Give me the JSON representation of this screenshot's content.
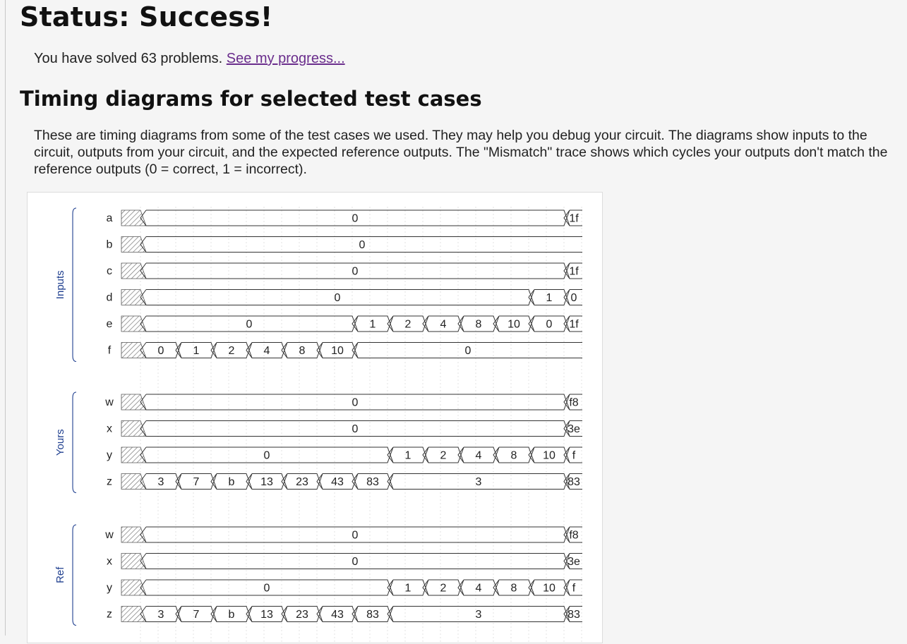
{
  "status": {
    "title": "Status: Success!"
  },
  "progress": {
    "text": "You have solved 63 problems.",
    "link": "See my progress..."
  },
  "section": {
    "title": "Timing diagrams for selected test cases",
    "description": "These are timing diagrams from some of the test cases we used. They may help you debug your circuit. The diagrams show inputs to the circuit, outputs from your circuit, and the expected reference outputs. The \"Mismatch\" trace shows which cycles your outputs don't match the reference outputs (0 = correct, 1 = incorrect)."
  },
  "colors": {
    "link": "#6a2d8c",
    "group_label": "#1f3f8f"
  },
  "timing": {
    "groups": [
      {
        "label": "Inputs",
        "signals": [
          {
            "name": "a",
            "values": [
              "0",
              "1f"
            ],
            "widths": [
              12,
              1
            ]
          },
          {
            "name": "b",
            "values": [
              "0"
            ],
            "widths": [
              13
            ]
          },
          {
            "name": "c",
            "values": [
              "0",
              "1f"
            ],
            "widths": [
              12,
              1
            ]
          },
          {
            "name": "d",
            "values": [
              "0",
              "1",
              "0"
            ],
            "widths": [
              11,
              1,
              1
            ]
          },
          {
            "name": "e",
            "values": [
              "0",
              "1",
              "2",
              "4",
              "8",
              "10",
              "0",
              "1f"
            ],
            "widths": [
              6,
              1,
              1,
              1,
              1,
              1,
              1,
              1
            ]
          },
          {
            "name": "f",
            "values": [
              "0",
              "1",
              "2",
              "4",
              "8",
              "10",
              "0"
            ],
            "widths": [
              1,
              1,
              1,
              1,
              1,
              1,
              7
            ]
          }
        ]
      },
      {
        "label": "Yours",
        "signals": [
          {
            "name": "w",
            "values": [
              "0",
              "f8"
            ],
            "widths": [
              12,
              1
            ]
          },
          {
            "name": "x",
            "values": [
              "0",
              "3e"
            ],
            "widths": [
              12,
              1
            ]
          },
          {
            "name": "y",
            "values": [
              "0",
              "1",
              "2",
              "4",
              "8",
              "10",
              "f"
            ],
            "widths": [
              7,
              1,
              1,
              1,
              1,
              1,
              1
            ]
          },
          {
            "name": "z",
            "values": [
              "3",
              "7",
              "b",
              "13",
              "23",
              "43",
              "83",
              "3",
              "83"
            ],
            "widths": [
              1,
              1,
              1,
              1,
              1,
              1,
              1,
              5,
              1
            ]
          }
        ]
      },
      {
        "label": "Ref",
        "signals": [
          {
            "name": "w",
            "values": [
              "0",
              "f8"
            ],
            "widths": [
              12,
              1
            ]
          },
          {
            "name": "x",
            "values": [
              "0",
              "3e"
            ],
            "widths": [
              12,
              1
            ]
          },
          {
            "name": "y",
            "values": [
              "0",
              "1",
              "2",
              "4",
              "8",
              "10",
              "f"
            ],
            "widths": [
              7,
              1,
              1,
              1,
              1,
              1,
              1
            ]
          },
          {
            "name": "z",
            "values": [
              "3",
              "7",
              "b",
              "13",
              "23",
              "43",
              "83",
              "3",
              "83"
            ],
            "widths": [
              1,
              1,
              1,
              1,
              1,
              1,
              1,
              5,
              1
            ]
          }
        ]
      }
    ]
  }
}
